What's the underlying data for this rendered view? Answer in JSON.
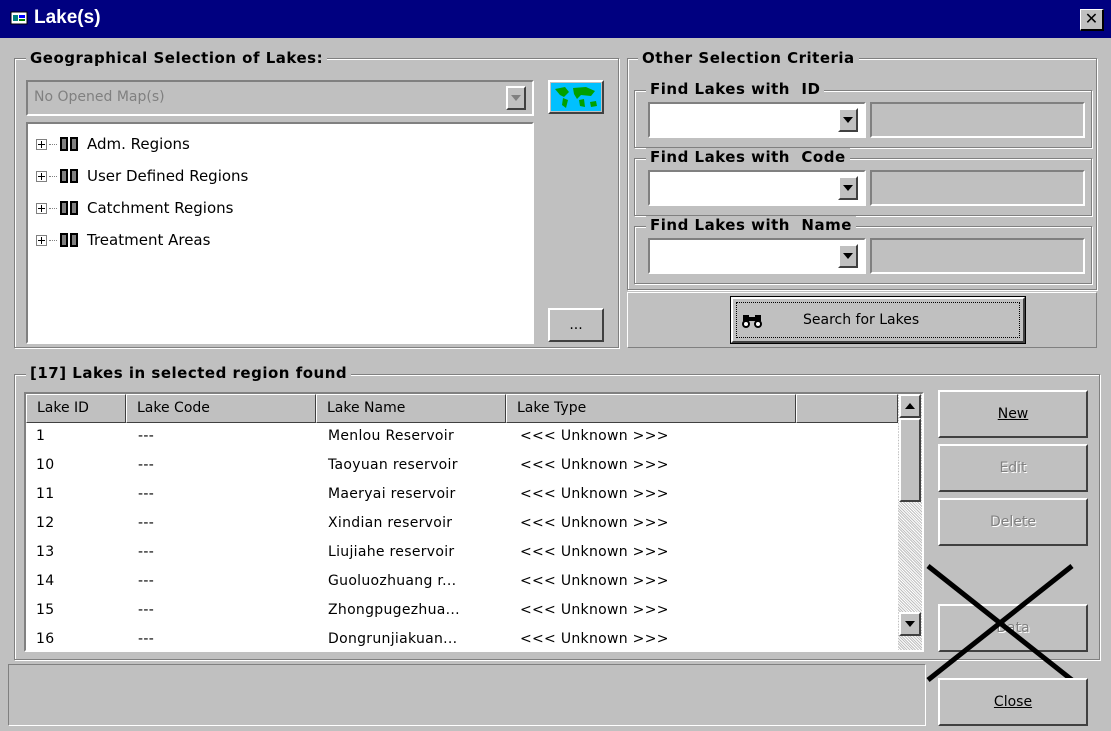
{
  "window": {
    "title": "Lake(s)"
  },
  "geo_group": {
    "label": "Geographical Selection of Lakes:",
    "map_select_value": "No Opened Map(s)",
    "browse_button": "...",
    "tree": [
      "Adm. Regions",
      "User Defined Regions",
      "Catchment Regions",
      "Treatment Areas"
    ]
  },
  "other_group": {
    "label": "Other Selection Criteria",
    "find_id_label": "Find Lakes with  ID",
    "find_code_label": "Find Lakes with  Code",
    "find_name_label": "Find Lakes with  Name",
    "search_button": "Search for Lakes"
  },
  "results": {
    "label": "[17] Lakes in selected region found",
    "columns": [
      "Lake ID",
      "Lake Code",
      "Lake Name",
      "Lake Type"
    ],
    "rows": [
      {
        "id": "1",
        "code": "---",
        "name": "Menlou Reservoir",
        "type": "<<< Unknown >>>"
      },
      {
        "id": "10",
        "code": "---",
        "name": "Taoyuan reservoir",
        "type": "<<< Unknown >>>"
      },
      {
        "id": "11",
        "code": "---",
        "name": "Maeryai reservoir",
        "type": "<<< Unknown >>>"
      },
      {
        "id": "12",
        "code": "---",
        "name": "Xindian reservoir",
        "type": "<<< Unknown >>>"
      },
      {
        "id": "13",
        "code": "---",
        "name": "Liujiahe reservoir",
        "type": "<<< Unknown >>>"
      },
      {
        "id": "14",
        "code": "---",
        "name": "Guoluozhuang r...",
        "type": "<<< Unknown >>>"
      },
      {
        "id": "15",
        "code": "---",
        "name": "Zhongpugezhua...",
        "type": "<<< Unknown >>>"
      },
      {
        "id": "16",
        "code": "---",
        "name": "Dongrunjiakuan...",
        "type": "<<< Unknown >>>"
      }
    ]
  },
  "buttons": {
    "new": "New",
    "edit": "Edit",
    "delete": "Delete",
    "data": "Data",
    "close": "Close"
  },
  "colors": {
    "titlebar": "#000080",
    "face": "#c0c0c0"
  }
}
